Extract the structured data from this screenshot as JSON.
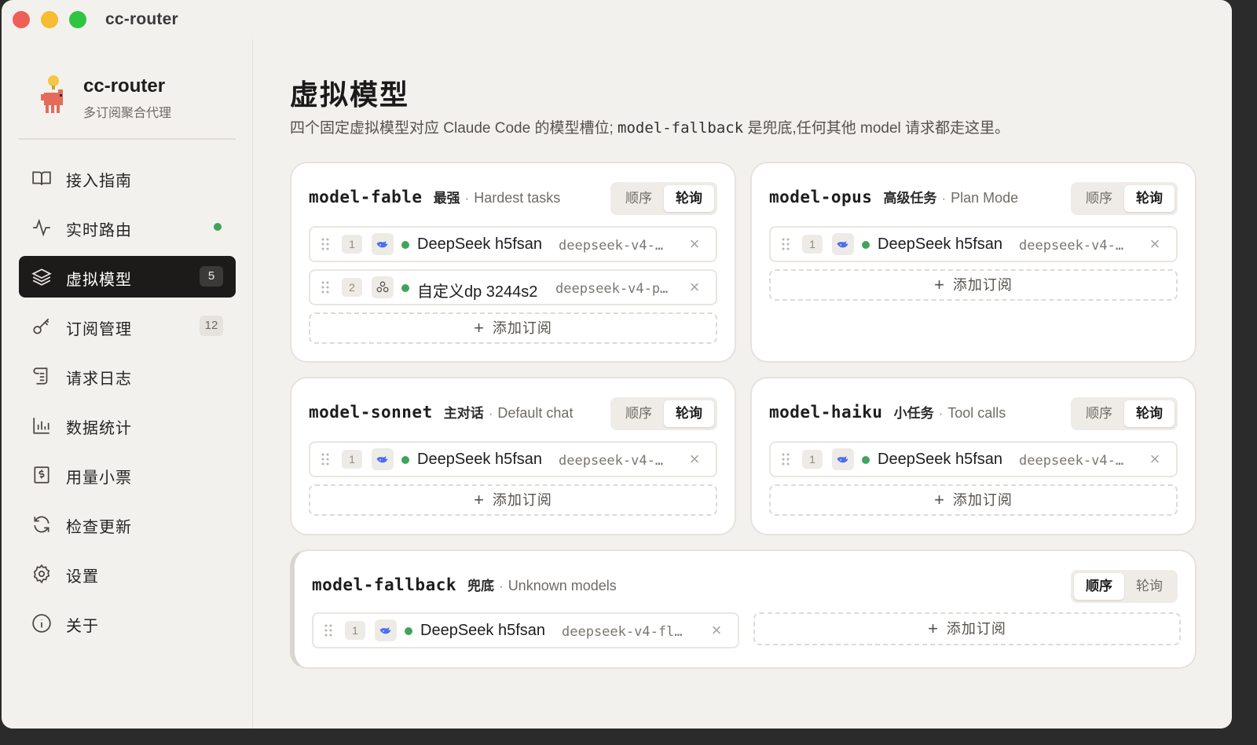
{
  "window": {
    "title": "cc-router"
  },
  "brand": {
    "name": "cc-router",
    "subtitle": "多订阅聚合代理"
  },
  "nav": [
    {
      "label": "接入指南",
      "icon": "book-open-icon"
    },
    {
      "label": "实时路由",
      "icon": "activity-icon",
      "status": "live"
    },
    {
      "label": "虚拟模型",
      "icon": "layers-icon",
      "badge": "5",
      "active": true
    },
    {
      "label": "订阅管理",
      "icon": "key-icon",
      "badge": "12"
    },
    {
      "label": "请求日志",
      "icon": "scroll-icon"
    },
    {
      "label": "数据统计",
      "icon": "bar-chart-icon"
    },
    {
      "label": "用量小票",
      "icon": "receipt-icon"
    },
    {
      "label": "检查更新",
      "icon": "refresh-icon"
    },
    {
      "label": "设置",
      "icon": "gear-icon"
    },
    {
      "label": "关于",
      "icon": "info-icon"
    }
  ],
  "page": {
    "title": "虚拟模型",
    "desc_pre": "四个固定虚拟模型对应 Claude Code 的模型槽位;",
    "desc_code": "model-fallback",
    "desc_post": "是兜底,任何其他 model 请求都走这里。"
  },
  "add_label": "添加订阅",
  "mode_labels": {
    "order": "顺序",
    "round_robin": "轮询"
  },
  "models": {
    "fable": {
      "name": "model-fable",
      "tag": "最强",
      "sep": "·",
      "desc": "Hardest tasks",
      "mode": "round_robin",
      "subs": [
        {
          "index": "1",
          "provider_icon": "whale-icon",
          "name": "DeepSeek h5fsan",
          "model": "deepseek-v4-…"
        },
        {
          "index": "2",
          "provider_icon": "custom-icon",
          "name": "自定义dp 3244s2",
          "model": "deepseek-v4-p…"
        }
      ]
    },
    "opus": {
      "name": "model-opus",
      "tag": "高级任务",
      "sep": "·",
      "desc": "Plan Mode",
      "mode": "round_robin",
      "subs": [
        {
          "index": "1",
          "provider_icon": "whale-icon",
          "name": "DeepSeek h5fsan",
          "model": "deepseek-v4-…"
        }
      ]
    },
    "sonnet": {
      "name": "model-sonnet",
      "tag": "主对话",
      "sep": "·",
      "desc": "Default chat",
      "mode": "round_robin",
      "subs": [
        {
          "index": "1",
          "provider_icon": "whale-icon",
          "name": "DeepSeek h5fsan",
          "model": "deepseek-v4-…"
        }
      ]
    },
    "haiku": {
      "name": "model-haiku",
      "tag": "小任务",
      "sep": "·",
      "desc": "Tool calls",
      "mode": "round_robin",
      "subs": [
        {
          "index": "1",
          "provider_icon": "whale-icon",
          "name": "DeepSeek h5fsan",
          "model": "deepseek-v4-…"
        }
      ]
    },
    "fallback": {
      "name": "model-fallback",
      "tag": "兜底",
      "sep": "·",
      "desc": "Unknown models",
      "mode": "order",
      "subs": [
        {
          "index": "1",
          "provider_icon": "whale-icon",
          "name": "DeepSeek h5fsan",
          "model": "deepseek-v4-fl…"
        }
      ]
    }
  },
  "colors": {
    "accent": "#1c1b1a",
    "status_ok": "#3fa45b",
    "whale": "#4a6cf7"
  }
}
